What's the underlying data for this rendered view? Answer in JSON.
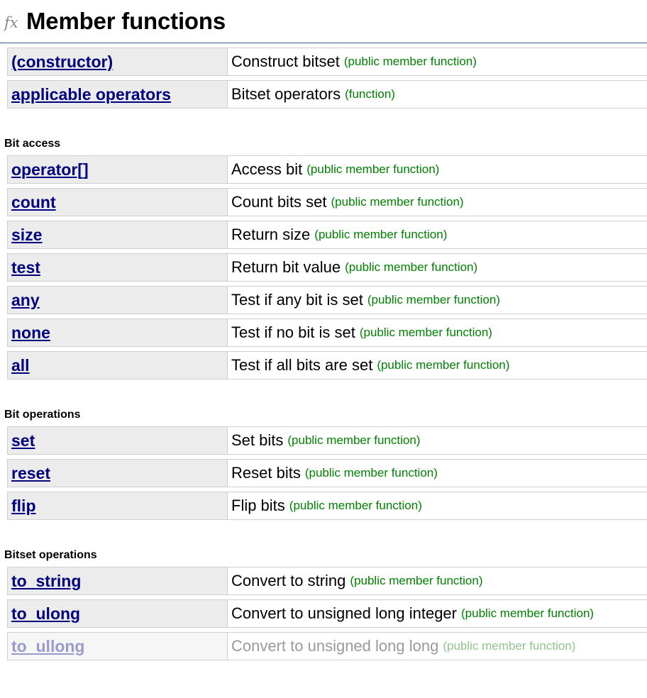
{
  "header": {
    "icon_text": "fx",
    "title": "Member functions"
  },
  "intro_rows": [
    {
      "name": "(constructor)",
      "desc": "Construct bitset",
      "kind": "(public member function)"
    },
    {
      "name": "applicable operators",
      "desc": "Bitset operators",
      "kind": "(function)"
    }
  ],
  "groups": [
    {
      "title": "Bit access",
      "rows": [
        {
          "name": "operator[]",
          "desc": "Access bit",
          "kind": "(public member function)"
        },
        {
          "name": "count",
          "desc": "Count bits set",
          "kind": "(public member function)"
        },
        {
          "name": "size",
          "desc": "Return size",
          "kind": "(public member function)"
        },
        {
          "name": "test",
          "desc": "Return bit value",
          "kind": "(public member function)"
        },
        {
          "name": "any",
          "desc": "Test if any bit is set",
          "kind": "(public member function)"
        },
        {
          "name": "none",
          "desc": "Test if no bit is set",
          "kind": "(public member function)"
        },
        {
          "name": "all",
          "desc": "Test if all bits are set",
          "kind": "(public member function)"
        }
      ]
    },
    {
      "title": "Bit operations",
      "rows": [
        {
          "name": "set",
          "desc": "Set bits",
          "kind": "(public member function)"
        },
        {
          "name": "reset",
          "desc": "Reset bits",
          "kind": "(public member function)"
        },
        {
          "name": "flip",
          "desc": "Flip bits",
          "kind": "(public member function)"
        }
      ]
    },
    {
      "title": "Bitset operations",
      "rows": [
        {
          "name": "to_string",
          "desc": "Convert to string",
          "kind": "(public member function)"
        },
        {
          "name": "to_ulong",
          "desc": "Convert to unsigned long integer",
          "kind": "(public member function)"
        },
        {
          "name": "to_ullong",
          "desc": "Convert to unsigned long long",
          "kind": "(public member function)"
        }
      ]
    }
  ]
}
